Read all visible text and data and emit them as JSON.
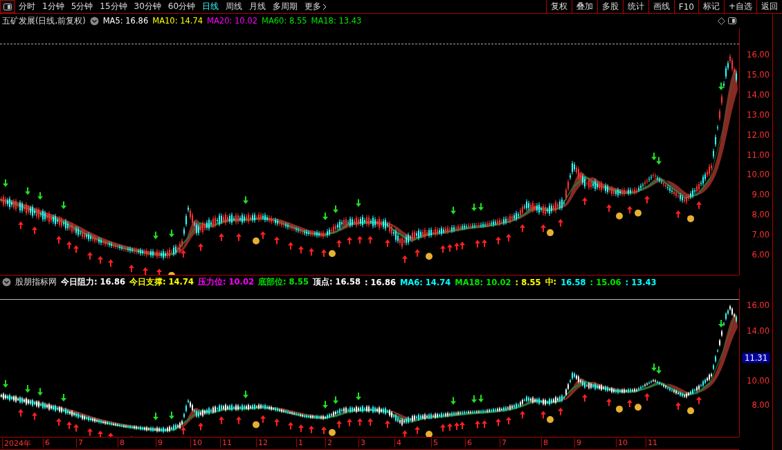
{
  "toolbar": {
    "tabs": [
      {
        "label": "分时",
        "selected": false
      },
      {
        "label": "1分钟",
        "selected": false
      },
      {
        "label": "5分钟",
        "selected": false
      },
      {
        "label": "15分钟",
        "selected": false
      },
      {
        "label": "30分钟",
        "selected": false
      },
      {
        "label": "60分钟",
        "selected": false
      },
      {
        "label": "日线",
        "selected": true
      },
      {
        "label": "周线",
        "selected": false
      },
      {
        "label": "月线",
        "selected": false
      },
      {
        "label": "多周期",
        "selected": false
      },
      {
        "label": "更多",
        "selected": false
      }
    ],
    "buttons": [
      "复权",
      "叠加",
      "多股",
      "统计",
      "画线",
      "F10",
      "标记",
      "+自选",
      "返回"
    ]
  },
  "main_chart": {
    "title": "五矿发展(日线,前复权)",
    "indicators": [
      {
        "text": "MA5: 16.86",
        "color": "#ffffff"
      },
      {
        "text": "MA10: 14.74",
        "color": "#ffff00"
      },
      {
        "text": "MA20: 10.02",
        "color": "#ff00ff"
      },
      {
        "text": "MA60: 8.55",
        "color": "#00e600"
      },
      {
        "text": "MA18: 13.43",
        "color": "#00e600"
      }
    ],
    "axis_labels": [
      "16.00",
      "15.00",
      "14.00",
      "13.00",
      "12.00",
      "11.00",
      "10.00",
      "9.00",
      "8.00",
      "7.00",
      "6.00"
    ]
  },
  "indicator_chart": {
    "title": "股朋指标网",
    "indicators": [
      {
        "text": "今日阻力: 16.86",
        "color": "#ffffff"
      },
      {
        "text": "今日支撑: 14.74",
        "color": "#ffff00"
      },
      {
        "text": "压力位: 10.02",
        "color": "#ff00ff"
      },
      {
        "text": "底部位: 8.55",
        "color": "#00e600"
      },
      {
        "text": "顶点: 16.58",
        "color": "#ffffff"
      },
      {
        "text": ": 16.86",
        "color": "#ffffff"
      },
      {
        "text": "MA6: 14.74",
        "color": "#00ffff"
      },
      {
        "text": "MA18: 10.02",
        "color": "#00e600"
      },
      {
        "text": ": 8.55",
        "color": "#ffff00"
      },
      {
        "text": "中:",
        "color": "#ffff00"
      },
      {
        "text": "16.58",
        "color": "#00ffff"
      },
      {
        "text": ": 15.06",
        "color": "#00e600"
      },
      {
        "text": ": 13.43",
        "color": "#00ffff"
      }
    ],
    "axis_labels": [
      {
        "text": "16.00",
        "highlighted": false
      },
      {
        "text": "14.00",
        "highlighted": false
      },
      {
        "text": "11.31",
        "highlighted": true
      },
      {
        "text": "10.00",
        "highlighted": false
      },
      {
        "text": "8.00",
        "highlighted": false
      }
    ]
  },
  "time_axis": [
    "2024年",
    "6",
    "7",
    "8",
    "9",
    "10",
    "11",
    "12",
    "1",
    "2",
    "3",
    "4",
    "5",
    "6",
    "7",
    "8",
    "9",
    "10",
    "11"
  ]
}
